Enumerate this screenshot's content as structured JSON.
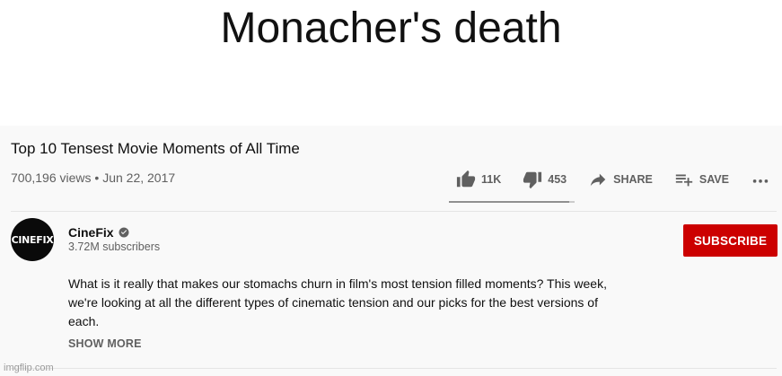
{
  "meme": {
    "caption": "Monacher's death"
  },
  "video": {
    "title": "Top 10 Tensest Movie Moments of All Time",
    "views": "700,196 views",
    "separator": "•",
    "date": "Jun 22, 2017"
  },
  "actions": {
    "like_count": "11K",
    "dislike_count": "453",
    "share_label": "SHARE",
    "save_label": "SAVE",
    "like_ratio": 0.96,
    "icons": [
      "thumbs-up-icon",
      "thumbs-down-icon",
      "share-icon",
      "playlist-add-icon",
      "more-icon"
    ]
  },
  "channel": {
    "name": "CineFix",
    "logo_text": "CINEFIX",
    "subscribers": "3.72M subscribers",
    "subscribe_label": "SUBSCRIBE",
    "verified_icon": "verified-check-icon"
  },
  "description": {
    "text": "What is it really that makes our stomachs churn in film's most tension filled moments? This week, we're looking at all the different types of cinematic tension and our picks for the best versions of each.",
    "show_more_label": "SHOW MORE"
  },
  "watermark": "imgflip.com",
  "colors": {
    "subscribe": "#cc0000",
    "secondary_text": "#606060",
    "background": "#f9f9f9"
  }
}
